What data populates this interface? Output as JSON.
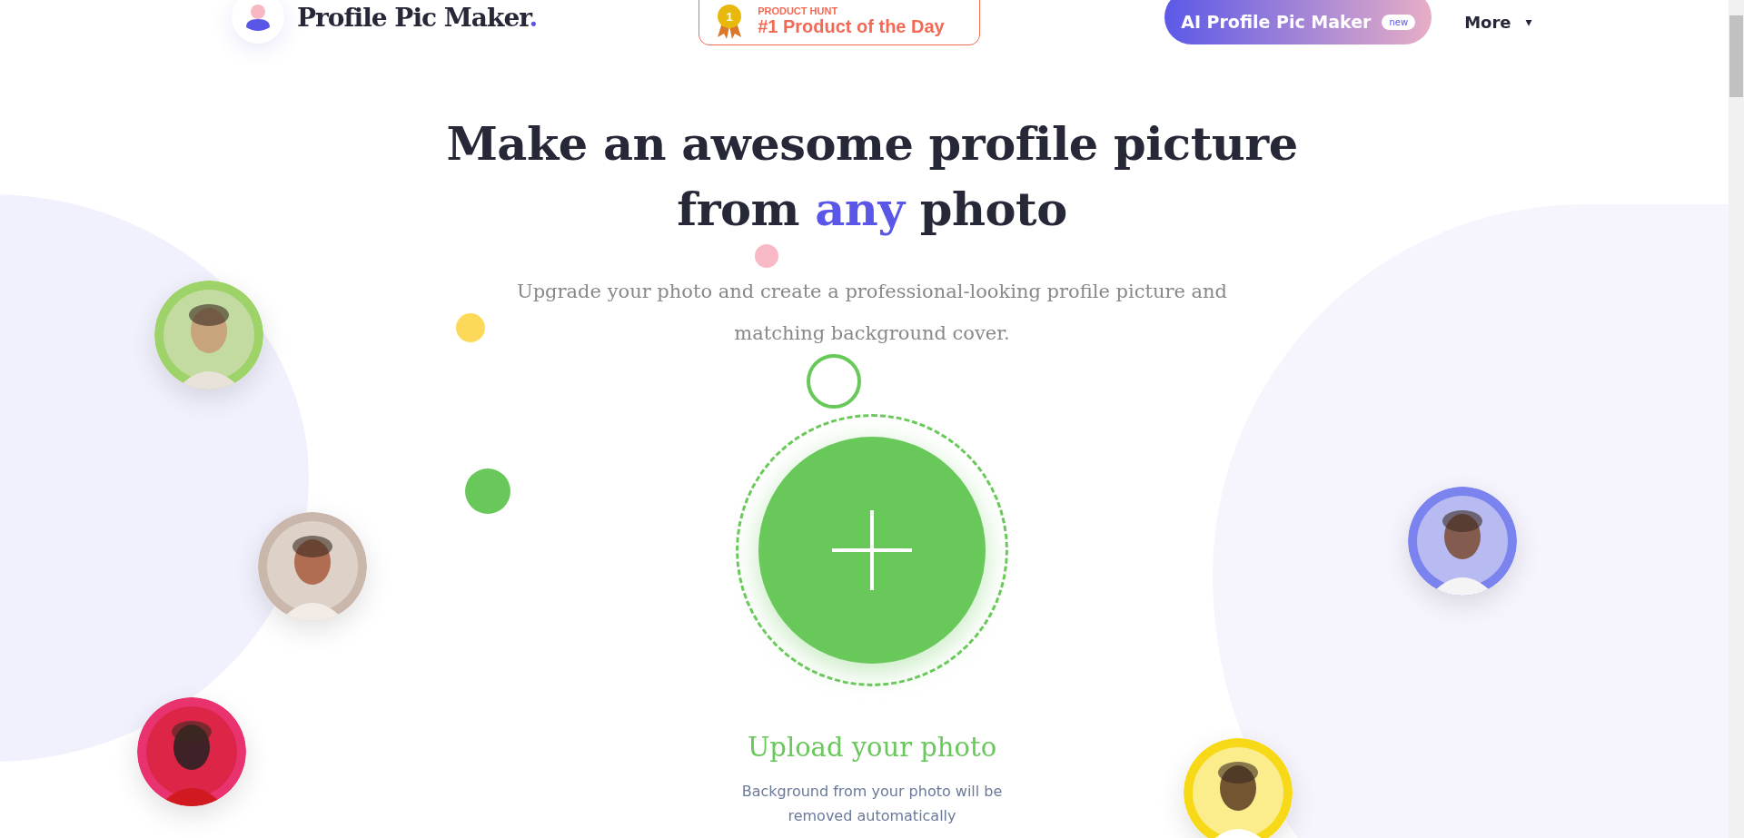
{
  "header": {
    "logo": {
      "text": "Profile Pic Maker",
      "dot": "."
    },
    "badge": {
      "eyebrow": "PRODUCT HUNT",
      "title": "#1 Product of the Day",
      "medal": "1"
    },
    "ai_button": {
      "label": "AI Profile Pic Maker",
      "tag": "new"
    },
    "more": {
      "label": "More",
      "caret": "▾"
    }
  },
  "hero": {
    "title_lines": [
      [
        {
          "text": "Make an awesome profile picture",
          "highlight": false
        }
      ],
      [
        {
          "text": "from ",
          "highlight": false
        },
        {
          "text": "any",
          "highlight": true
        },
        {
          "text": " photo",
          "highlight": false
        }
      ]
    ],
    "subtitle": "Upgrade your photo and create a professional-looking profile picture and matching background cover."
  },
  "upload": {
    "label": "Upload your photo",
    "note": "Background from your photo will be removed automatically"
  }
}
